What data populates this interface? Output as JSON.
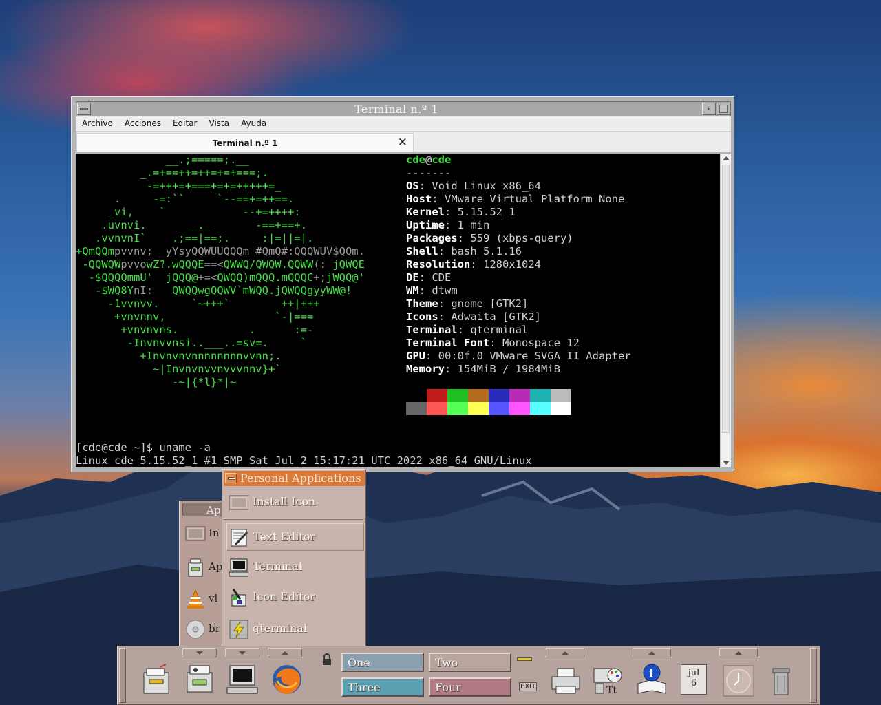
{
  "terminal": {
    "window_title": "Terminal n.º 1",
    "menu": [
      "Archivo",
      "Acciones",
      "Editar",
      "Vista",
      "Ayuda"
    ],
    "tab_label": "Terminal n.º 1",
    "tab_close": "✕",
    "neofetch": {
      "user": "cde",
      "at": "@",
      "host": "cde",
      "separator": "-------",
      "fields": [
        {
          "key": "OS",
          "value": "Void Linux x86_64"
        },
        {
          "key": "Host",
          "value": "VMware Virtual Platform None"
        },
        {
          "key": "Kernel",
          "value": "5.15.52_1"
        },
        {
          "key": "Uptime",
          "value": "1 min"
        },
        {
          "key": "Packages",
          "value": "559 (xbps-query)"
        },
        {
          "key": "Shell",
          "value": "bash 5.1.16"
        },
        {
          "key": "Resolution",
          "value": "1280x1024"
        },
        {
          "key": "DE",
          "value": "CDE"
        },
        {
          "key": "WM",
          "value": "dtwm"
        },
        {
          "key": "Theme",
          "value": "gnome [GTK2]"
        },
        {
          "key": "Icons",
          "value": "Adwaita [GTK2]"
        },
        {
          "key": "Terminal",
          "value": "qterminal"
        },
        {
          "key": "Terminal Font",
          "value": "Monospace 12"
        },
        {
          "key": "GPU",
          "value": "00:0f.0 VMware SVGA II Adapter"
        },
        {
          "key": "Memory",
          "value": "154MiB / 1984MiB"
        }
      ],
      "palette_top": [
        "#000000",
        "#c21b1b",
        "#1fbf1f",
        "#b26a1d",
        "#2a2ab8",
        "#b82ab8",
        "#1fb3b3",
        "#bcbcbc"
      ],
      "palette_bottom": [
        "#666666",
        "#ff5555",
        "#55ff55",
        "#ffff55",
        "#5555ff",
        "#ff55ff",
        "#55ffff",
        "#ffffff"
      ],
      "logo_lines": [
        [
          "              __.;=====;.__",
          ""
        ],
        [
          "          _.=+==++=++=+=+===;.",
          ""
        ],
        [
          "           -=+++=+===+=+=+++++=_",
          ""
        ],
        [
          "      .     -=:``     `--==+=++==.",
          ""
        ],
        [
          "     _vi,    `            --+=++++:",
          ""
        ],
        [
          "    .uvnvi.       _._       -==+==+.",
          ""
        ],
        [
          "   .vvnvnI`    .;==|==;.     :|=||=|.",
          ""
        ],
        [
          "+QmQQm",
          "pvvnv; _yYsyQQWUUQQQm #QmQ#:QQQWUV$QQm."
        ],
        [
          " -QQWQW",
          "pvvo",
          "wZ?.wQQQE",
          "==<",
          "QWWQ/QWQW.QQWW",
          "(: ",
          "jQWQE"
        ],
        [
          "  -$QQQQmmU'  jQQQ@",
          "+=<",
          "QWQQ)mQQQ.mQQQC",
          "+;",
          "jWQQ@'"
        ],
        [
          "   -$WQ8Y",
          "nI:   ",
          "QWQQwgQQWV`mWQQ.jQWQQgyyWW@!"
        ],
        [
          "     -1vvnvv.     `~+++`        ++|+++",
          ""
        ],
        [
          "      +vnvnnv,                 `-|===",
          ""
        ],
        [
          "       +vnvnvns.           .      :=-",
          ""
        ],
        [
          "        -Invnvvnsi..___..=sv=.     `",
          ""
        ],
        [
          "          +Invnvnvnnnnnnnnvvnn;.",
          ""
        ],
        [
          "            ~|Invnvnvvnvvvnnv}+`",
          ""
        ],
        [
          "               -~|{*l}*|~",
          ""
        ]
      ]
    },
    "prompt": "[cde@cde ~]$ uname -a",
    "output": "Linux cde 5.15.52_1 #1 SMP Sat Jul 2 15:17:21 UTC 2022 x86_64 GNU/Linux"
  },
  "applications_back": {
    "title": "Ap",
    "rows": [
      "In",
      "Ap",
      "vl",
      "br"
    ]
  },
  "personal_apps_menu": {
    "title": "Personal Applications",
    "items": [
      {
        "label": "Install Icon",
        "icon": "install-icon"
      },
      {
        "label": "Text Editor",
        "icon": "text-editor-icon"
      },
      {
        "label": "Terminal",
        "icon": "terminal-icon"
      },
      {
        "label": "Icon Editor",
        "icon": "icon-editor-icon"
      },
      {
        "label": "qterminal",
        "icon": "qterminal-icon"
      }
    ]
  },
  "front_panel": {
    "workspaces": [
      {
        "label": "One",
        "color": "#8aa0b0"
      },
      {
        "label": "Two",
        "color": "#b9a59e"
      },
      {
        "label": "Three",
        "color": "#5aa0b0"
      },
      {
        "label": "Four",
        "color": "#b07a84"
      }
    ],
    "exit_label": "EXIT",
    "calendar_month": "jul",
    "calendar_day": "6"
  }
}
